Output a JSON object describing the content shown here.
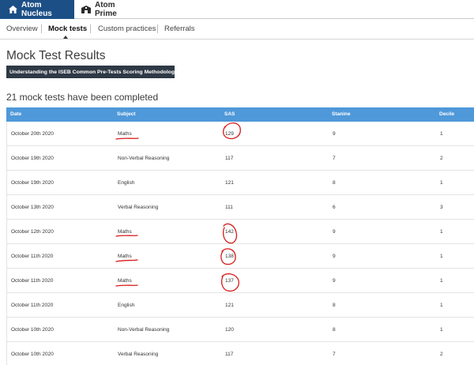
{
  "top_tabs": [
    {
      "label": "Atom Nucleus",
      "icon": "home-icon",
      "active": true
    },
    {
      "label": "Atom Prime",
      "icon": "school-icon",
      "active": false
    }
  ],
  "subnav": [
    {
      "label": "Overview",
      "active": false
    },
    {
      "label": "Mock tests",
      "active": true
    },
    {
      "label": "Custom practices",
      "active": false
    },
    {
      "label": "Referrals",
      "active": false
    }
  ],
  "page": {
    "title": "Mock Test Results",
    "methodology_button": "Understanding the ISEB Common Pre-Tests Scoring Methodology",
    "completed_text": "21 mock tests have been completed"
  },
  "table": {
    "columns": [
      "Date",
      "Subject",
      "SAS",
      "Stanine",
      "Decile"
    ],
    "rows": [
      {
        "date": "October 20th 2020",
        "subject": "Maths",
        "sas": "129",
        "stanine": "9",
        "decile": "1"
      },
      {
        "date": "October 19th 2020",
        "subject": "Non-Verbal Reasoning",
        "sas": "117",
        "stanine": "7",
        "decile": "2"
      },
      {
        "date": "October 19th 2020",
        "subject": "English",
        "sas": "121",
        "stanine": "8",
        "decile": "1"
      },
      {
        "date": "October 13th 2020",
        "subject": "Verbal Reasoning",
        "sas": "111",
        "stanine": "6",
        "decile": "3"
      },
      {
        "date": "October 12th 2020",
        "subject": "Maths",
        "sas": "142",
        "stanine": "9",
        "decile": "1"
      },
      {
        "date": "October 11th 2020",
        "subject": "Maths",
        "sas": "138",
        "stanine": "9",
        "decile": "1"
      },
      {
        "date": "October 11th 2020",
        "subject": "Maths",
        "sas": "137",
        "stanine": "9",
        "decile": "1"
      },
      {
        "date": "October 11th 2020",
        "subject": "English",
        "sas": "121",
        "stanine": "8",
        "decile": "1"
      },
      {
        "date": "October 10th 2020",
        "subject": "Non-Verbal Reasoning",
        "sas": "120",
        "stanine": "8",
        "decile": "1"
      },
      {
        "date": "October 10th 2020",
        "subject": "Verbal Reasoning",
        "sas": "117",
        "stanine": "7",
        "decile": "2"
      }
    ]
  },
  "colors": {
    "active_tab": "#1c4f86",
    "table_header": "#4f98d9",
    "method_button": "#2e3946",
    "annotation": "#d81b1b"
  }
}
